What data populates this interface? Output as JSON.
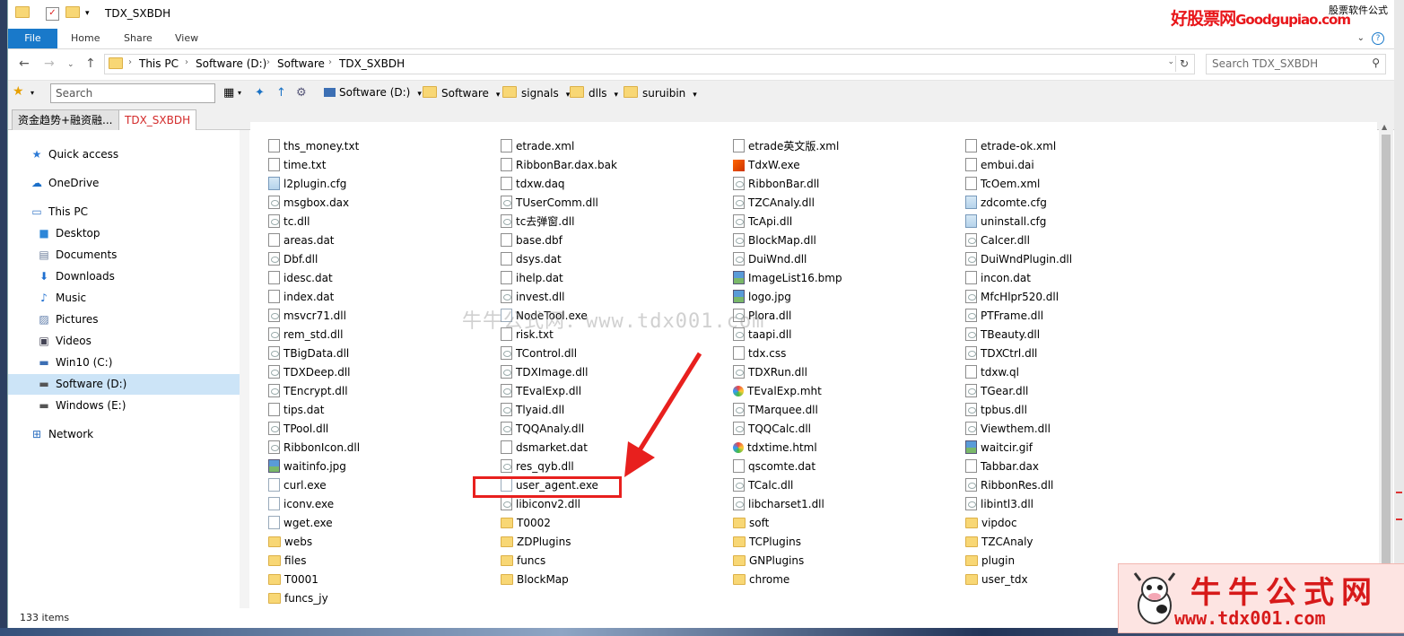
{
  "window": {
    "title": "TDX_SXBDH",
    "brand_ad_cn": "好股票网",
    "brand_ad_en": "Goodgupiao.com",
    "brand_small": "股票软件公式"
  },
  "ribbon": {
    "tabs": [
      "File",
      "Home",
      "Share",
      "View"
    ]
  },
  "address": {
    "crumbs": [
      "This PC",
      "Software (D:)",
      "Software",
      "TDX_SXBDH"
    ],
    "search_placeholder": "Search TDX_SXBDH"
  },
  "toolbar": {
    "search_label": "Search",
    "crumbs": [
      "Software (D:)",
      "Software",
      "signals",
      "dlls",
      "suruibin"
    ]
  },
  "tabs": [
    "资金趋势+融资融...",
    "TDX_SXBDH"
  ],
  "nav": [
    {
      "label": "Quick access",
      "icon": "star-icon"
    },
    {
      "label": "OneDrive",
      "icon": "cloud-icon"
    },
    {
      "label": "This PC",
      "icon": "computer-icon"
    },
    {
      "label": "Desktop",
      "icon": "desktop-icon"
    },
    {
      "label": "Documents",
      "icon": "documents-icon"
    },
    {
      "label": "Downloads",
      "icon": "download-icon"
    },
    {
      "label": "Music",
      "icon": "music-icon"
    },
    {
      "label": "Pictures",
      "icon": "pictures-icon"
    },
    {
      "label": "Videos",
      "icon": "videos-icon"
    },
    {
      "label": "Win10 (C:)",
      "icon": "drive-icon"
    },
    {
      "label": "Software (D:)",
      "icon": "drive-icon"
    },
    {
      "label": "Windows (E:)",
      "icon": "drive-icon"
    },
    {
      "label": "Network",
      "icon": "network-icon"
    }
  ],
  "files": [
    [
      {
        "name": "ths_money.txt",
        "type": "txt"
      },
      {
        "name": "time.txt",
        "type": "txt"
      },
      {
        "name": "l2plugin.cfg",
        "type": "cfg"
      },
      {
        "name": "msgbox.dax",
        "type": "gear"
      },
      {
        "name": "tc.dll",
        "type": "gear"
      },
      {
        "name": "areas.dat",
        "type": "txt"
      },
      {
        "name": "Dbf.dll",
        "type": "gear"
      },
      {
        "name": "idesc.dat",
        "type": "txt"
      },
      {
        "name": "index.dat",
        "type": "txt"
      },
      {
        "name": "msvcr71.dll",
        "type": "gear"
      },
      {
        "name": "rem_std.dll",
        "type": "gear"
      },
      {
        "name": "TBigData.dll",
        "type": "gear"
      },
      {
        "name": "TDXDeep.dll",
        "type": "gear"
      },
      {
        "name": "TEncrypt.dll",
        "type": "gear"
      },
      {
        "name": "tips.dat",
        "type": "txt"
      },
      {
        "name": "TPool.dll",
        "type": "gear"
      },
      {
        "name": "RibbonIcon.dll",
        "type": "gear"
      },
      {
        "name": "waitinfo.jpg",
        "type": "img"
      },
      {
        "name": "curl.exe",
        "type": "exe"
      },
      {
        "name": "iconv.exe",
        "type": "exe"
      },
      {
        "name": "wget.exe",
        "type": "exe"
      },
      {
        "name": "webs",
        "type": "folder"
      },
      {
        "name": "files",
        "type": "folder"
      },
      {
        "name": "T0001",
        "type": "folder"
      },
      {
        "name": "funcs_jy",
        "type": "folder"
      }
    ],
    [
      {
        "name": "etrade.xml",
        "type": "txt"
      },
      {
        "name": "RibbonBar.dax.bak",
        "type": "txt"
      },
      {
        "name": "tdxw.daq",
        "type": "txt"
      },
      {
        "name": "TUserComm.dll",
        "type": "gear"
      },
      {
        "name": "tc去弹窗.dll",
        "type": "gear"
      },
      {
        "name": "base.dbf",
        "type": "txt"
      },
      {
        "name": "dsys.dat",
        "type": "txt"
      },
      {
        "name": "ihelp.dat",
        "type": "txt"
      },
      {
        "name": "invest.dll",
        "type": "gear"
      },
      {
        "name": "NodeTool.exe",
        "type": "exe"
      },
      {
        "name": "risk.txt",
        "type": "txt"
      },
      {
        "name": "TControl.dll",
        "type": "gear"
      },
      {
        "name": "TDXImage.dll",
        "type": "gear"
      },
      {
        "name": "TEvalExp.dll",
        "type": "gear"
      },
      {
        "name": "Tlyaid.dll",
        "type": "gear"
      },
      {
        "name": "TQQAnaly.dll",
        "type": "gear"
      },
      {
        "name": "dsmarket.dat",
        "type": "txt"
      },
      {
        "name": "res_qyb.dll",
        "type": "gear"
      },
      {
        "name": "user_agent.exe",
        "type": "exe"
      },
      {
        "name": "libiconv2.dll",
        "type": "gear"
      },
      {
        "name": "T0002",
        "type": "folder"
      },
      {
        "name": "ZDPlugins",
        "type": "folder"
      },
      {
        "name": "funcs",
        "type": "folder"
      },
      {
        "name": "BlockMap",
        "type": "folder"
      }
    ],
    [
      {
        "name": "etrade英文版.xml",
        "type": "txt"
      },
      {
        "name": "TdxW.exe",
        "type": "orange"
      },
      {
        "name": "RibbonBar.dll",
        "type": "gear"
      },
      {
        "name": "TZCAnaly.dll",
        "type": "gear"
      },
      {
        "name": "TcApi.dll",
        "type": "gear"
      },
      {
        "name": "BlockMap.dll",
        "type": "gear"
      },
      {
        "name": "DuiWnd.dll",
        "type": "gear"
      },
      {
        "name": "ImageList16.bmp",
        "type": "img"
      },
      {
        "name": "logo.jpg",
        "type": "img"
      },
      {
        "name": "Plora.dll",
        "type": "gear"
      },
      {
        "name": "taapi.dll",
        "type": "gear"
      },
      {
        "name": "tdx.css",
        "type": "txt"
      },
      {
        "name": "TDXRun.dll",
        "type": "gear"
      },
      {
        "name": "TEvalExp.mht",
        "type": "web"
      },
      {
        "name": "TMarquee.dll",
        "type": "gear"
      },
      {
        "name": "TQQCalc.dll",
        "type": "gear"
      },
      {
        "name": "tdxtime.html",
        "type": "web"
      },
      {
        "name": "qscomte.dat",
        "type": "txt"
      },
      {
        "name": "TCalc.dll",
        "type": "gear"
      },
      {
        "name": "libcharset1.dll",
        "type": "gear"
      },
      {
        "name": "soft",
        "type": "folder"
      },
      {
        "name": "TCPlugins",
        "type": "folder"
      },
      {
        "name": "GNPlugins",
        "type": "folder"
      },
      {
        "name": "chrome",
        "type": "folder"
      }
    ],
    [
      {
        "name": "etrade-ok.xml",
        "type": "txt"
      },
      {
        "name": "embui.dai",
        "type": "txt"
      },
      {
        "name": "TcOem.xml",
        "type": "txt"
      },
      {
        "name": "zdcomte.cfg",
        "type": "cfg"
      },
      {
        "name": "uninstall.cfg",
        "type": "cfg"
      },
      {
        "name": "Calcer.dll",
        "type": "gear"
      },
      {
        "name": "DuiWndPlugin.dll",
        "type": "gear"
      },
      {
        "name": "incon.dat",
        "type": "txt"
      },
      {
        "name": "MfcHlpr520.dll",
        "type": "gear"
      },
      {
        "name": "PTFrame.dll",
        "type": "gear"
      },
      {
        "name": "TBeauty.dll",
        "type": "gear"
      },
      {
        "name": "TDXCtrl.dll",
        "type": "gear"
      },
      {
        "name": "tdxw.ql",
        "type": "txt"
      },
      {
        "name": "TGear.dll",
        "type": "gear"
      },
      {
        "name": "tpbus.dll",
        "type": "gear"
      },
      {
        "name": "Viewthem.dll",
        "type": "gear"
      },
      {
        "name": "waitcir.gif",
        "type": "img"
      },
      {
        "name": "Tabbar.dax",
        "type": "txt"
      },
      {
        "name": "RibbonRes.dll",
        "type": "gear"
      },
      {
        "name": "libintl3.dll",
        "type": "gear"
      },
      {
        "name": "vipdoc",
        "type": "folder"
      },
      {
        "name": "TZCAnaly",
        "type": "folder"
      },
      {
        "name": "plugin",
        "type": "folder"
      },
      {
        "name": "user_tdx",
        "type": "folder"
      }
    ]
  ],
  "status": {
    "count": "133 items"
  },
  "overlay": {
    "watermark": "牛牛公式网：www.tdx001.com",
    "logo_title": "牛牛公式网",
    "logo_url": "www.tdx001.com"
  },
  "colors": {
    "accent": "#1979ca",
    "highlight": "#e8201e",
    "brand_red": "#d71a1a"
  }
}
